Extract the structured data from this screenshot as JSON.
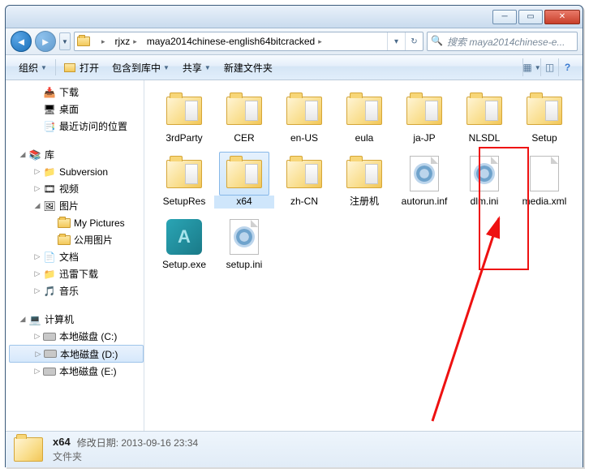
{
  "breadcrumbs": [
    "rjxz",
    "maya2014chinese-english64bitcracked"
  ],
  "search_placeholder": "搜索 maya2014chinese-e...",
  "toolbar": {
    "organize": "组织",
    "open": "打开",
    "include": "包含到库中",
    "share": "共享",
    "newfolder": "新建文件夹"
  },
  "tree": {
    "downloads": "下载",
    "desktop": "桌面",
    "recent": "最近访问的位置",
    "libraries": "库",
    "subversion": "Subversion",
    "videos": "视频",
    "pictures": "图片",
    "mypictures": "My Pictures",
    "publicpictures": "公用图片",
    "documents": "文档",
    "xunlei": "迅雷下载",
    "music": "音乐",
    "computer": "计算机",
    "diskC": "本地磁盘 (C:)",
    "diskD": "本地磁盘 (D:)",
    "diskE": "本地磁盘 (E:)"
  },
  "items": [
    {
      "name": "3rdParty",
      "type": "folder"
    },
    {
      "name": "CER",
      "type": "folder"
    },
    {
      "name": "en-US",
      "type": "folder"
    },
    {
      "name": "eula",
      "type": "folder"
    },
    {
      "name": "ja-JP",
      "type": "folder"
    },
    {
      "name": "NLSDL",
      "type": "folder"
    },
    {
      "name": "Setup",
      "type": "folder"
    },
    {
      "name": "SetupRes",
      "type": "folder"
    },
    {
      "name": "x64",
      "type": "folder",
      "selected": true
    },
    {
      "name": "zh-CN",
      "type": "folder"
    },
    {
      "name": "注册机",
      "type": "folder",
      "highlighted": true
    },
    {
      "name": "autorun.inf",
      "type": "ini"
    },
    {
      "name": "dlm.ini",
      "type": "ini"
    },
    {
      "name": "media.xml",
      "type": "file"
    },
    {
      "name": "Setup.exe",
      "type": "exe"
    },
    {
      "name": "setup.ini",
      "type": "ini"
    }
  ],
  "status": {
    "name": "x64",
    "modlabel": "修改日期:",
    "modvalue": "2013-09-16 23:34",
    "type": "文件夹"
  }
}
